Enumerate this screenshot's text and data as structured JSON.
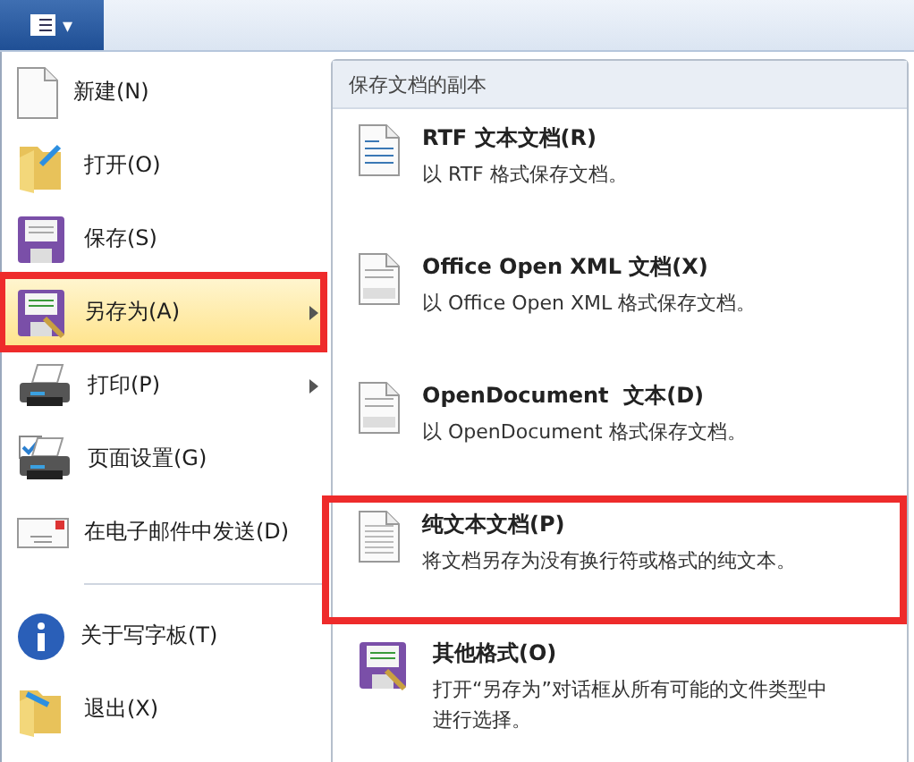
{
  "menu_button": {
    "caret": "▾"
  },
  "menu": [
    {
      "kind": "item",
      "label": "新建(N)",
      "selected": false,
      "submenu": false,
      "annotated": false
    },
    {
      "kind": "item",
      "label": "打开(O)",
      "selected": false,
      "submenu": false,
      "annotated": false
    },
    {
      "kind": "item",
      "label": "保存(S)",
      "selected": false,
      "submenu": false,
      "annotated": false
    },
    {
      "kind": "item",
      "label": "另存为(A)",
      "selected": true,
      "submenu": true,
      "annotated": true
    },
    {
      "kind": "item",
      "label": "打印(P)",
      "selected": false,
      "submenu": true,
      "annotated": false
    },
    {
      "kind": "item",
      "label": "页面设置(G)",
      "selected": false,
      "submenu": false,
      "annotated": false
    },
    {
      "kind": "item",
      "label": "在电子邮件中发送(D)",
      "selected": false,
      "submenu": false,
      "annotated": false
    },
    {
      "kind": "separator"
    },
    {
      "kind": "item",
      "label": "关于写字板(T)",
      "selected": false,
      "submenu": false,
      "annotated": false
    },
    {
      "kind": "item",
      "label": "退出(X)",
      "selected": false,
      "submenu": false,
      "annotated": false
    }
  ],
  "submenu": {
    "title": "保存文档的副本",
    "items": [
      {
        "title": "RTF 文本文档(R)",
        "description": "以 RTF 格式保存文档。",
        "annotated": false
      },
      {
        "title": "Office Open XML 文档(X)",
        "description": "以 Office Open XML 格式保存文档。",
        "annotated": false
      },
      {
        "title": "OpenDocument  文本(D)",
        "description": "以 OpenDocument 格式保存文档。",
        "annotated": false
      },
      {
        "title": "纯文本文档(P)",
        "description": "将文档另存为没有换行符或格式的纯文本。",
        "annotated": true
      },
      {
        "title": "其他格式(O)",
        "description": "打开“另存为”对话框从所有可能的文件类型中进行选择。",
        "annotated": false
      }
    ]
  }
}
